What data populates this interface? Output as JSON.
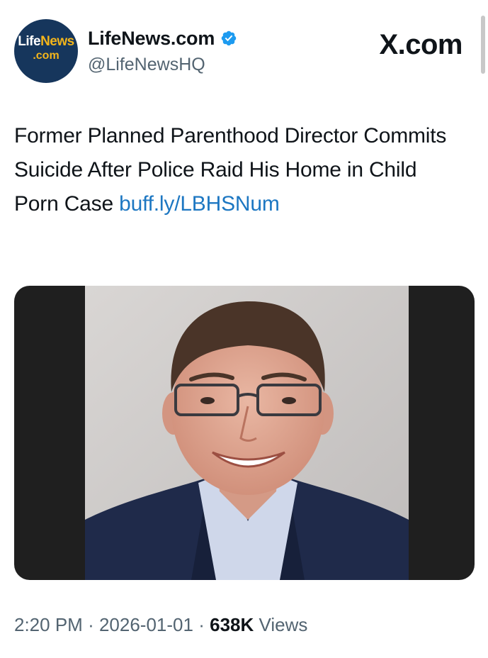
{
  "account": {
    "display_name": "LifeNews.com",
    "handle": "@LifeNewsHQ",
    "verified": true,
    "avatar_logo_text": "LifeNews.com"
  },
  "brand": "X.com",
  "tweet": {
    "text": "Former Planned Parenthood Director Commits Suicide After Police Raid His Home in Child Porn Case",
    "link": "buff.ly/LBHSNum"
  },
  "media": {
    "type": "photo"
  },
  "meta": {
    "time": "2:20 PM",
    "separator": "·",
    "date": "2026-01-01",
    "views_count": "638K",
    "views_label": "Views"
  },
  "colors": {
    "link": "#1d77c2",
    "verified": "#1d9bf0",
    "secondary_text": "#536471",
    "avatar_bg": "#16365c",
    "avatar_accent": "#f3b51b"
  }
}
